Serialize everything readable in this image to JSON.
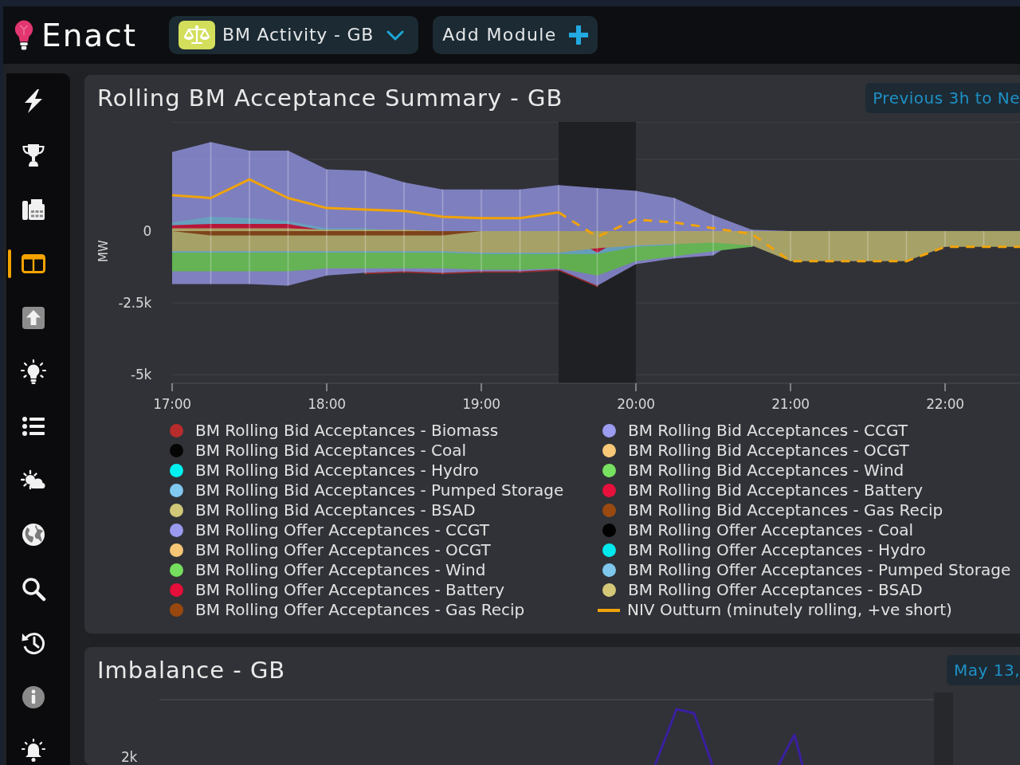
{
  "topbar": {
    "logo": "Enact",
    "module_dropdown": "BM Activity - GB",
    "add_button": "Add Module"
  },
  "sidebar": {
    "items": [
      {
        "selected": false
      },
      {
        "selected": false
      },
      {
        "selected": false
      },
      {
        "selected": true
      },
      {
        "selected": false
      },
      {
        "selected": false
      },
      {
        "selected": false
      },
      {
        "selected": false
      },
      {
        "selected": false
      },
      {
        "selected": false
      },
      {
        "selected": false
      },
      {
        "selected": false
      },
      {
        "selected": false
      }
    ]
  },
  "panels": [
    {
      "title": "Rolling BM Acceptance Summary - GB",
      "range": "Previous 3h to Ne",
      "chart_data": {
        "type": "area",
        "grid": "y",
        "ylabel": "MW",
        "x": [
          17,
          17.25,
          17.5,
          17.75,
          18,
          18.25,
          18.5,
          18.75,
          19,
          19.25,
          19.5,
          19.75,
          20,
          20.25,
          20.5,
          20.75,
          21,
          21.25,
          21.5,
          21.75,
          22,
          22.25,
          22.5
        ],
        "xlim": [
          17,
          22.5
        ],
        "ylim": [
          -5300,
          3800
        ],
        "xticks": [
          {
            "value": 17,
            "label": "17:00"
          },
          {
            "value": 18,
            "label": "18:00"
          },
          {
            "value": 19,
            "label": "19:00"
          },
          {
            "value": 20,
            "label": "20:00"
          },
          {
            "value": 21,
            "label": "21:00"
          },
          {
            "value": 22,
            "label": "22:00"
          }
        ],
        "yticks": [
          {
            "value": 0,
            "label": "0"
          },
          {
            "value": -2500,
            "label": "-2.5k"
          },
          {
            "value": -5000,
            "label": "-5k"
          }
        ],
        "series": [
          {
            "name": "BM Rolling Bid Acceptances - Biomass",
            "color": "#b82c2c",
            "values": [
              0,
              0,
              0,
              0,
              0,
              -1500,
              -1450,
              -1500,
              -1450,
              -1450,
              -1380,
              -1950,
              0,
              0,
              0,
              0,
              0,
              0,
              0,
              0,
              0,
              0,
              0
            ]
          },
          {
            "name": "BM Rolling Bid Acceptances - CCGT",
            "color": "#9c9cf0",
            "values": [
              -1850,
              -1850,
              -1850,
              -1900,
              -1550,
              -1450,
              -1400,
              -1450,
              -1400,
              -1400,
              -1330,
              -1900,
              -1150,
              -950,
              -850,
              0,
              0,
              0,
              0,
              0,
              0,
              0,
              0
            ]
          },
          {
            "name": "BM Rolling Bid Acceptances - Coal",
            "color": "#050505",
            "values": [
              null,
              null,
              null,
              null,
              null,
              null,
              null,
              null,
              null,
              null,
              null,
              null,
              null,
              null,
              null,
              null,
              null,
              null,
              null,
              null,
              null,
              null,
              null
            ]
          },
          {
            "name": "BM Rolling Bid Acceptances - OCGT",
            "color": "#f8c878",
            "values": [
              null,
              null,
              null,
              null,
              null,
              null,
              null,
              null,
              null,
              null,
              null,
              null,
              null,
              null,
              null,
              null,
              null,
              null,
              null,
              null,
              null,
              null,
              null
            ]
          },
          {
            "name": "BM Rolling Bid Acceptances - Hydro",
            "color": "#00f0f0",
            "values": [
              null,
              null,
              null,
              null,
              null,
              null,
              null,
              null,
              null,
              null,
              null,
              null,
              null,
              null,
              null,
              null,
              null,
              null,
              null,
              null,
              null,
              null,
              null
            ]
          },
          {
            "name": "BM Rolling Bid Acceptances - Wind",
            "color": "#78e060",
            "values": [
              -1400,
              -1400,
              -1400,
              -1400,
              -1300,
              -1300,
              -1300,
              -1300,
              -1350,
              -1350,
              -1300,
              -1550,
              -1050,
              -880,
              -700,
              -550,
              0,
              0,
              0,
              0,
              0,
              0,
              0
            ]
          },
          {
            "name": "BM Rolling Bid Acceptances - Pumped Storage",
            "color": "#80c8f0",
            "values": [
              -750,
              -750,
              -750,
              -750,
              -750,
              -750,
              -750,
              -750,
              -800,
              -800,
              -800,
              -800,
              -550,
              -480,
              0,
              0,
              0,
              0,
              0,
              0,
              0,
              0,
              0
            ]
          },
          {
            "name": "BM Rolling Bid Acceptances - Battery",
            "color": "#e8103c",
            "values": [
              0,
              0,
              0,
              0,
              0,
              0,
              0,
              0,
              0,
              0,
              0,
              -750,
              0,
              0,
              0,
              0,
              0,
              0,
              0,
              0,
              0,
              0,
              0
            ]
          },
          {
            "name": "BM Rolling Bid Acceptances - BSAD",
            "color": "#d0c878",
            "values": [
              -700,
              -700,
              -700,
              -700,
              -700,
              -700,
              -700,
              -700,
              -750,
              -750,
              -750,
              -600,
              -500,
              -450,
              -400,
              -500,
              -1050,
              -1050,
              -1050,
              -1050,
              -550,
              -550,
              -550
            ]
          },
          {
            "name": "BM Rolling Bid Acceptances - Gas Recip",
            "color": "#9a4a10",
            "values": [
              0,
              -150,
              -150,
              -150,
              -150,
              -150,
              -150,
              -150,
              0,
              0,
              0,
              0,
              0,
              0,
              0,
              0,
              0,
              0,
              0,
              0,
              0,
              0,
              0
            ]
          },
          {
            "name": "BM Rolling Offer Acceptances - CCGT",
            "color": "#9a9aee",
            "values": [
              2750,
              3100,
              2800,
              2800,
              2150,
              2100,
              1700,
              1450,
              1450,
              1450,
              1600,
              1500,
              1400,
              1150,
              550,
              50,
              0,
              0,
              0,
              0,
              0,
              0,
              0
            ]
          },
          {
            "name": "BM Rolling Offer Acceptances - Coal",
            "color": "#000000",
            "values": [
              null,
              null,
              null,
              null,
              null,
              null,
              null,
              null,
              null,
              null,
              null,
              null,
              null,
              null,
              null,
              null,
              null,
              null,
              null,
              null,
              null,
              null,
              null
            ]
          },
          {
            "name": "BM Rolling Offer Acceptances - OCGT",
            "color": "#f6c676",
            "values": [
              null,
              null,
              null,
              null,
              null,
              null,
              null,
              null,
              null,
              null,
              null,
              null,
              null,
              null,
              null,
              null,
              null,
              null,
              null,
              null,
              null,
              null,
              null
            ]
          },
          {
            "name": "BM Rolling Offer Acceptances - Hydro",
            "color": "#00eaee",
            "values": [
              null,
              null,
              null,
              null,
              null,
              null,
              null,
              null,
              null,
              null,
              null,
              null,
              null,
              null,
              null,
              null,
              null,
              null,
              null,
              null,
              null,
              null,
              null
            ]
          },
          {
            "name": "BM Rolling Offer Acceptances - Wind",
            "color": "#76de5e",
            "values": [
              null,
              null,
              null,
              null,
              null,
              null,
              null,
              null,
              null,
              null,
              null,
              null,
              null,
              null,
              null,
              null,
              null,
              null,
              null,
              null,
              null,
              null,
              null
            ]
          },
          {
            "name": "BM Rolling Offer Acceptances - Pumped Storage",
            "color": "#7ec6ec",
            "values": [
              300,
              500,
              450,
              350,
              100,
              100,
              0,
              0,
              0,
              0,
              0,
              0,
              0,
              0,
              0,
              0,
              0,
              0,
              0,
              0,
              0,
              0,
              0
            ]
          },
          {
            "name": "BM Rolling Offer Acceptances - Battery",
            "color": "#e60e3a",
            "values": [
              200,
              250,
              250,
              250,
              0,
              0,
              0,
              0,
              0,
              0,
              0,
              0,
              0,
              0,
              0,
              0,
              0,
              0,
              0,
              0,
              0,
              0,
              0
            ]
          },
          {
            "name": "BM Rolling Offer Acceptances - BSAD",
            "color": "#d4c878",
            "values": [
              100,
              100,
              100,
              100,
              50,
              50,
              50,
              0,
              0,
              0,
              0,
              0,
              0,
              0,
              0,
              0,
              0,
              0,
              0,
              0,
              0,
              0,
              0
            ]
          },
          {
            "name": "BM Rolling Offer Acceptances - Gas Recip",
            "color": "#98480e",
            "values": [
              null,
              null,
              null,
              null,
              null,
              null,
              null,
              null,
              null,
              null,
              null,
              null,
              null,
              null,
              null,
              null,
              null,
              null,
              null,
              null,
              null,
              null,
              null
            ]
          },
          {
            "name": "NIV Outturn (minutely rolling, +ve short)",
            "color": "#f0a30a",
            "type": "line",
            "line_style": "dashed",
            "values": [
              1250,
              1150,
              1800,
              1150,
              800,
              750,
              700,
              500,
              450,
              450,
              650,
              -200,
              400,
              300,
              100,
              -100,
              -1050,
              -1050,
              -1050,
              -1050,
              -550,
              -550,
              -550
            ]
          }
        ],
        "bands": [
          {
            "axis": "x",
            "from": 19.5,
            "to": 20
          }
        ]
      }
    },
    {
      "title": "Imbalance - GB",
      "range": "May 13,",
      "axis_labels": [
        "2k"
      ]
    }
  ]
}
